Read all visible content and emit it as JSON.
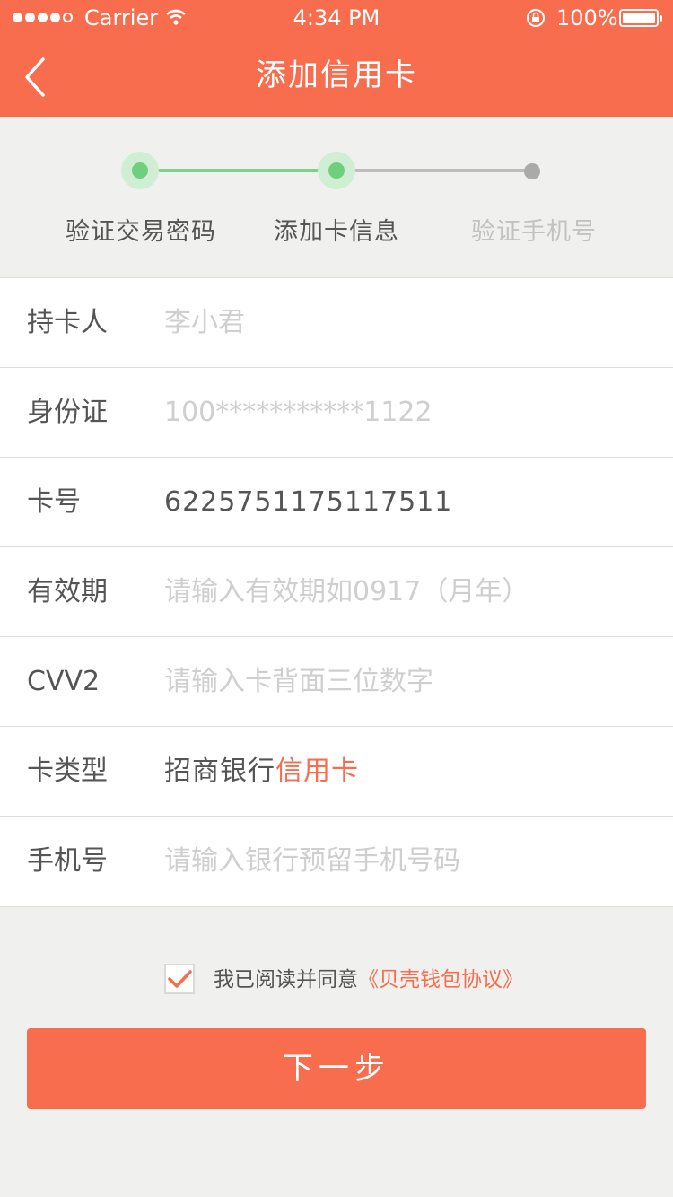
{
  "status_bar": {
    "carrier": "Carrier",
    "time": "4:34 PM",
    "battery": "100%"
  },
  "header": {
    "title": "添加信用卡",
    "background": "#f76d4d"
  },
  "steps": [
    {
      "label": "验证交易密码",
      "state": "done"
    },
    {
      "label": "添加卡信息",
      "state": "current"
    },
    {
      "label": "验证手机号",
      "state": "pending"
    }
  ],
  "form": {
    "cardholder": {
      "label": "持卡人",
      "placeholder": "李小君"
    },
    "id_number": {
      "label": "身份证",
      "placeholder": "100***********1122"
    },
    "card_number": {
      "label": "卡号",
      "value": "6225751175117511"
    },
    "expiry": {
      "label": "有效期",
      "placeholder": "请输入有效期如0917（月年）"
    },
    "cvv2": {
      "label": "CVV2",
      "placeholder": "请输入卡背面三位数字"
    },
    "card_type": {
      "label": "卡类型",
      "bank": "招商银行",
      "type": "信用卡"
    },
    "phone": {
      "label": "手机号",
      "placeholder": "请输入银行预留手机号码"
    }
  },
  "agreement": {
    "checked": true,
    "text": "我已阅读并同意",
    "link": "《贝壳钱包协议》"
  },
  "next_button": {
    "label": "下一步"
  },
  "colors": {
    "accent": "#f76d4d",
    "step_done": "#6fcf7e",
    "background": "#f0f0ef"
  }
}
